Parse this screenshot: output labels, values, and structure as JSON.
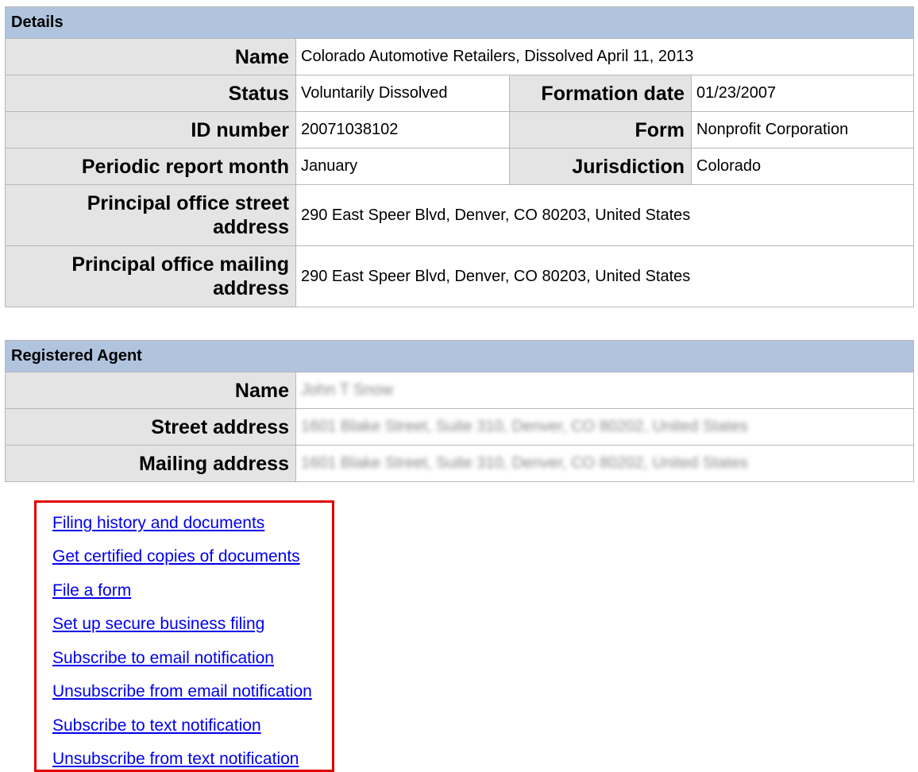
{
  "details": {
    "header": "Details",
    "rows": [
      {
        "label": "Name",
        "value": "Colorado Automotive Retailers, Dissolved April 11, 2013"
      },
      {
        "label": "Status",
        "value": "Voluntarily Dissolved",
        "label2": "Formation date",
        "value2": "01/23/2007"
      },
      {
        "label": "ID number",
        "value": "20071038102",
        "label2": "Form",
        "value2": "Nonprofit Corporation"
      },
      {
        "label": "Periodic report month",
        "value": "January",
        "label2": "Jurisdiction",
        "value2": "Colorado"
      },
      {
        "label": "Principal office street address",
        "value": "290 East Speer Blvd, Denver, CO 80203, United States"
      },
      {
        "label": "Principal office mailing address",
        "value": "290 East Speer Blvd, Denver, CO 80203, United States"
      }
    ]
  },
  "agent": {
    "header": "Registered Agent",
    "rows": [
      {
        "label": "Name",
        "value": "John T Snow"
      },
      {
        "label": "Street address",
        "value": "1601 Blake Street, Suite 310, Denver, CO 80202, United States"
      },
      {
        "label": "Mailing address",
        "value": "1601 Blake Street, Suite 310, Denver, CO 80202, United States"
      }
    ]
  },
  "links": [
    "Filing history and documents",
    "Get certified copies of documents",
    "File a form",
    "Set up secure business filing",
    "Subscribe to email notification",
    "Unsubscribe from email notification",
    "Subscribe to text notification",
    "Unsubscribe from text notification"
  ],
  "colors": {
    "header_bg": "#b0c4de",
    "label_bg": "#e4e4e4",
    "link": "#0000ee",
    "highlight_border": "#e00000"
  }
}
